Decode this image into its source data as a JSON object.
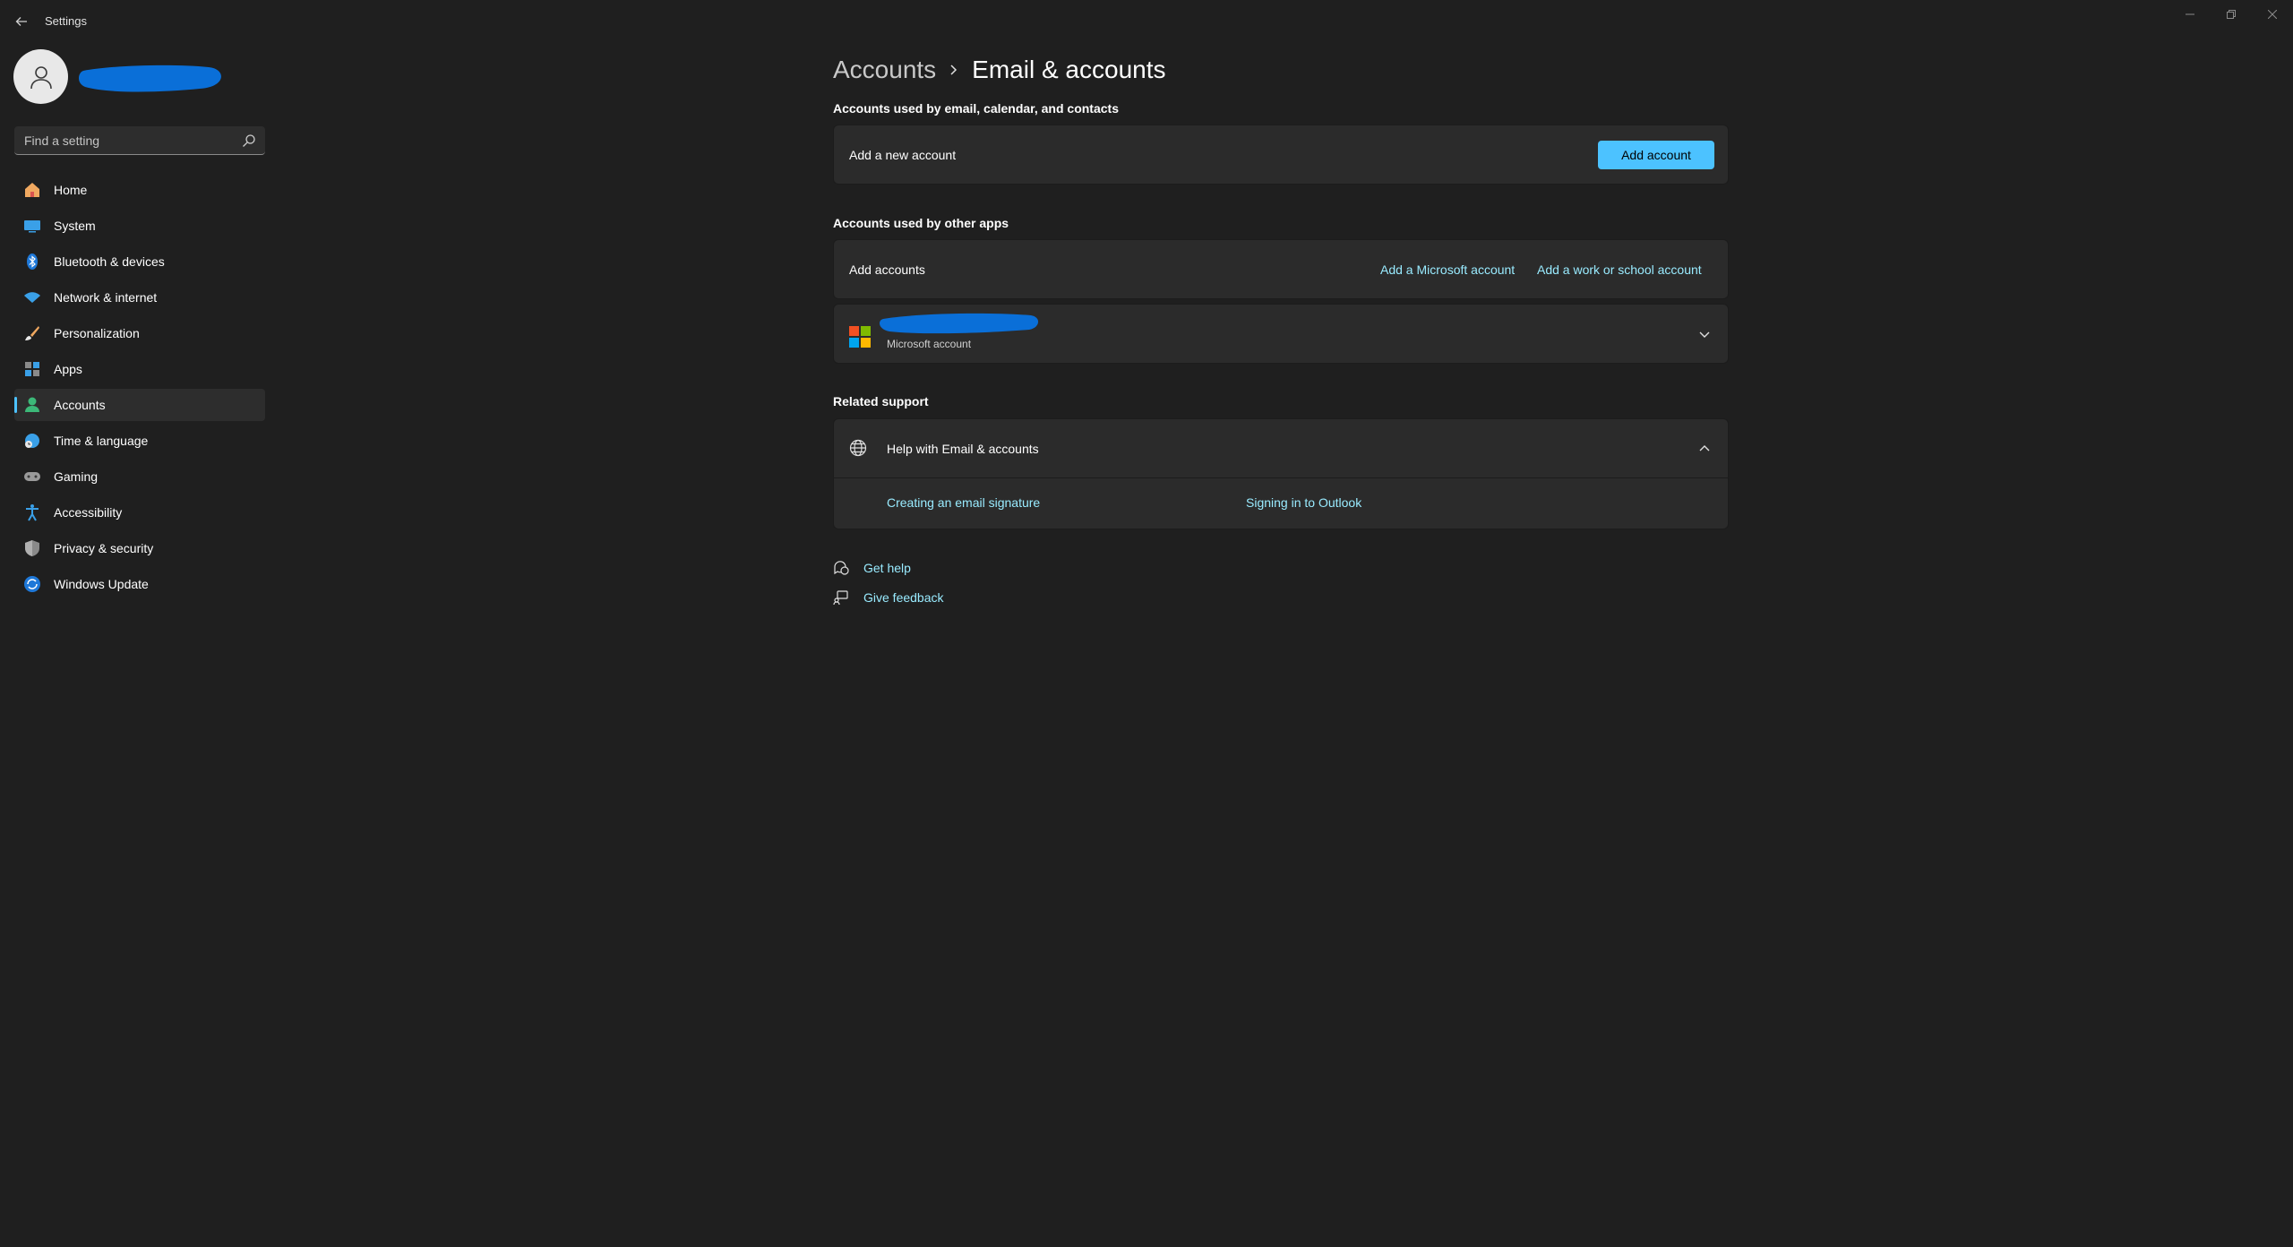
{
  "window": {
    "title": "Settings"
  },
  "sidebar": {
    "search": {
      "placeholder": "Find a setting"
    },
    "items": [
      {
        "label": "Home",
        "icon": "home-icon",
        "active": false
      },
      {
        "label": "System",
        "icon": "system-icon",
        "active": false
      },
      {
        "label": "Bluetooth & devices",
        "icon": "bluetooth-icon",
        "active": false
      },
      {
        "label": "Network & internet",
        "icon": "wifi-icon",
        "active": false
      },
      {
        "label": "Personalization",
        "icon": "brush-icon",
        "active": false
      },
      {
        "label": "Apps",
        "icon": "apps-icon",
        "active": false
      },
      {
        "label": "Accounts",
        "icon": "accounts-icon",
        "active": true
      },
      {
        "label": "Time & language",
        "icon": "globe-clock-icon",
        "active": false
      },
      {
        "label": "Gaming",
        "icon": "gamepad-icon",
        "active": false
      },
      {
        "label": "Accessibility",
        "icon": "accessibility-icon",
        "active": false
      },
      {
        "label": "Privacy & security",
        "icon": "shield-icon",
        "active": false
      },
      {
        "label": "Windows Update",
        "icon": "update-icon",
        "active": false
      }
    ]
  },
  "breadcrumb": {
    "parent": "Accounts",
    "current": "Email & accounts"
  },
  "email_section": {
    "title": "Accounts used by email, calendar, and contacts",
    "row_label": "Add a new account",
    "button_label": "Add account"
  },
  "other_apps_section": {
    "title": "Accounts used by other apps",
    "row_label": "Add accounts",
    "link_microsoft": "Add a Microsoft account",
    "link_work": "Add a work or school account",
    "account_subtitle": "Microsoft account"
  },
  "related_support": {
    "title": "Related support",
    "help_title": "Help with Email & accounts",
    "links": [
      "Creating an email signature",
      "Signing in to Outlook"
    ]
  },
  "footer": {
    "get_help": "Get help",
    "give_feedback": "Give feedback"
  },
  "colors": {
    "accent": "#4cc2ff",
    "link": "#99ebff",
    "background": "#1f1f1f",
    "card": "#2b2b2b",
    "redaction": "#0a6fd8"
  }
}
